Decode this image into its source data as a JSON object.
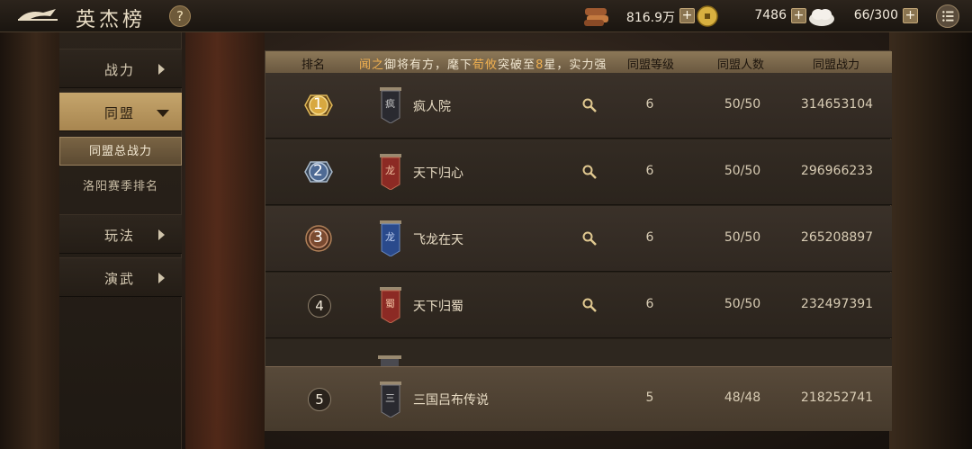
{
  "header": {
    "title": "英杰榜",
    "help": "?",
    "resources": {
      "copper": "816.9万",
      "gold": "7486",
      "stamina": "66/300"
    },
    "plus": "+"
  },
  "nav": {
    "items": [
      {
        "label": "战力"
      },
      {
        "label": "同盟"
      },
      {
        "label": "玩法"
      },
      {
        "label": "演武"
      }
    ],
    "subitems": [
      {
        "label": "同盟总战力"
      },
      {
        "label": "洛阳赛季排名"
      }
    ]
  },
  "table": {
    "headers": {
      "rank": "排名",
      "level": "同盟等级",
      "members": "同盟人数",
      "power": "同盟战力"
    },
    "announcement": {
      "name": "闻之",
      "mid": "御将有方，麾下",
      "hero": "荀攸",
      "tail1": "突破至",
      "stars": "8",
      "tail2": "星，实力强"
    },
    "rows": [
      {
        "rank": "1",
        "name": "疯人院",
        "banner_char": "疯",
        "level": "6",
        "members": "50/50",
        "power": "314653104"
      },
      {
        "rank": "2",
        "name": "天下归心",
        "banner_char": "龙",
        "level": "6",
        "members": "50/50",
        "power": "296966233"
      },
      {
        "rank": "3",
        "name": "飞龙在天",
        "banner_char": "龙",
        "level": "6",
        "members": "50/50",
        "power": "265208897"
      },
      {
        "rank": "4",
        "name": "天下归蜀",
        "banner_char": "蜀",
        "level": "6",
        "members": "50/50",
        "power": "232497391"
      }
    ],
    "self": {
      "rank": "5",
      "name": "三国吕布传说",
      "banner_char": "三",
      "level": "5",
      "members": "48/48",
      "power": "218252741"
    }
  },
  "colors": {
    "gold_badge": "#c89a3c",
    "silver_badge": "#5a7aa8",
    "bronze_badge": "#8a5a3c",
    "banner_red": "#8c2a24",
    "banner_blue": "#2a4a8c",
    "banner_dark": "#2a2a30"
  }
}
